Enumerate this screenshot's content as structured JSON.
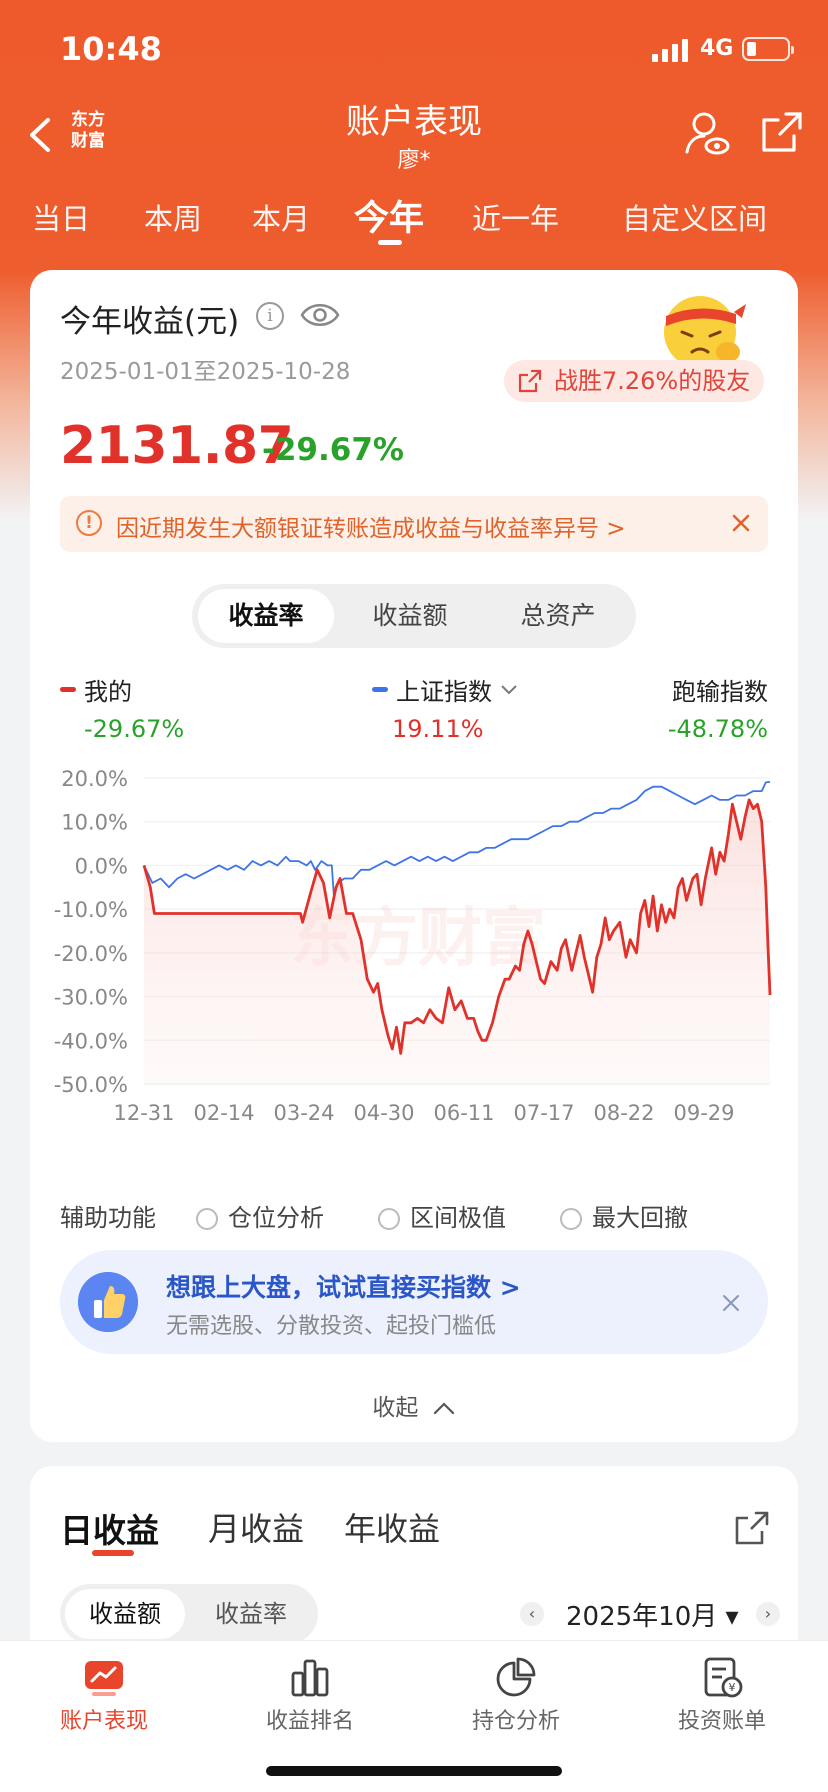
{
  "status": {
    "time": "10:48",
    "network": "4G"
  },
  "header": {
    "logo": "东方财富",
    "title": "账户表现",
    "subtitle": "廖*"
  },
  "periods": [
    "当日",
    "本周",
    "本月",
    "今年",
    "近一年",
    "自定义区间"
  ],
  "active_period": "今年",
  "summary": {
    "title": "今年收益(元)",
    "date_range": "2025-01-01至2025-10-28",
    "beat": "战胜7.26%的股友",
    "amount": "2131.87",
    "rate": "-29.67%",
    "notice": "因近期发生大额银证转账造成收益与收益率异号 >"
  },
  "segments": [
    "收益率",
    "收益额",
    "总资产"
  ],
  "legend": {
    "mine_label": "我的",
    "mine_value": "-29.67%",
    "index_label": "上证指数",
    "index_value": "19.11%",
    "diff_label": "跑输指数",
    "diff_value": "-48.78%"
  },
  "colors": {
    "brand": "#ee5a2b",
    "mine": "#e0322b",
    "index": "#3f74e6",
    "gain": "#2aa22a",
    "loss": "#e0322b"
  },
  "chart_data": {
    "type": "line",
    "x_tick_labels": [
      "12-31",
      "02-14",
      "03-24",
      "04-30",
      "06-11",
      "07-17",
      "08-22",
      "09-29"
    ],
    "y_tick_labels": [
      "20.0%",
      "10.0%",
      "0.0%",
      "-10.0%",
      "-20.0%",
      "-30.0%",
      "-40.0%",
      "-50.0%"
    ],
    "ylim": [
      -50,
      20
    ],
    "grid": true,
    "x_extent": [
      0,
      300
    ],
    "x_note": "days since 2024-12-31",
    "series": [
      {
        "name": "我的",
        "points": [
          [
            0,
            0
          ],
          [
            3,
            -5
          ],
          [
            5,
            -11
          ],
          [
            20,
            -11
          ],
          [
            40,
            -11
          ],
          [
            60,
            -11
          ],
          [
            75,
            -11
          ],
          [
            76,
            -13
          ],
          [
            80,
            -6
          ],
          [
            83,
            -1
          ],
          [
            86,
            -4
          ],
          [
            89,
            -12
          ],
          [
            92,
            -5
          ],
          [
            94,
            -3
          ],
          [
            97,
            -11
          ],
          [
            100,
            -11
          ],
          [
            104,
            -17
          ],
          [
            107,
            -26
          ],
          [
            110,
            -29
          ],
          [
            112,
            -27
          ],
          [
            114,
            -33
          ],
          [
            117,
            -39
          ],
          [
            119,
            -42
          ],
          [
            121,
            -37
          ],
          [
            123,
            -43
          ],
          [
            125,
            -36
          ],
          [
            128,
            -36
          ],
          [
            131,
            -35
          ],
          [
            134,
            -36
          ],
          [
            137,
            -33
          ],
          [
            140,
            -35
          ],
          [
            143,
            -36
          ],
          [
            146,
            -28
          ],
          [
            149,
            -33
          ],
          [
            152,
            -31
          ],
          [
            155,
            -35
          ],
          [
            158,
            -35
          ],
          [
            160,
            -38
          ],
          [
            162,
            -40
          ],
          [
            164,
            -40
          ],
          [
            167,
            -36
          ],
          [
            170,
            -30
          ],
          [
            173,
            -26
          ],
          [
            175,
            -26
          ],
          [
            178,
            -23
          ],
          [
            180,
            -24
          ],
          [
            182,
            -18
          ],
          [
            184,
            -15
          ],
          [
            186,
            -18
          ],
          [
            188,
            -22
          ],
          [
            190,
            -26
          ],
          [
            192,
            -27
          ],
          [
            195,
            -22
          ],
          [
            198,
            -24
          ],
          [
            200,
            -19
          ],
          [
            202,
            -17
          ],
          [
            205,
            -24
          ],
          [
            207,
            -20
          ],
          [
            209,
            -16
          ],
          [
            211,
            -21
          ],
          [
            213,
            -25
          ],
          [
            215,
            -29
          ],
          [
            217,
            -21
          ],
          [
            219,
            -18
          ],
          [
            221,
            -12
          ],
          [
            223,
            -17
          ],
          [
            225,
            -15
          ],
          [
            228,
            -13
          ],
          [
            231,
            -21
          ],
          [
            233,
            -17
          ],
          [
            236,
            -20
          ],
          [
            238,
            -11
          ],
          [
            240,
            -8
          ],
          [
            242,
            -14
          ],
          [
            244,
            -7
          ],
          [
            246,
            -15
          ],
          [
            248,
            -9
          ],
          [
            250,
            -13
          ],
          [
            252,
            -10
          ],
          [
            254,
            -12
          ],
          [
            256,
            -5
          ],
          [
            258,
            -3
          ],
          [
            260,
            -8
          ],
          [
            263,
            -3
          ],
          [
            265,
            -2
          ],
          [
            267,
            -9
          ],
          [
            269,
            -3
          ],
          [
            272,
            4
          ],
          [
            274,
            -2
          ],
          [
            276,
            3
          ],
          [
            278,
            1
          ],
          [
            280,
            7
          ],
          [
            282,
            14
          ],
          [
            284,
            10
          ],
          [
            286,
            6
          ],
          [
            288,
            11
          ],
          [
            290,
            15
          ],
          [
            292,
            13
          ],
          [
            294,
            14
          ],
          [
            296,
            10
          ],
          [
            298,
            -5
          ],
          [
            299,
            -18
          ],
          [
            300,
            -29.67
          ]
        ]
      },
      {
        "name": "上证指数",
        "points": [
          [
            0,
            0
          ],
          [
            4,
            -4
          ],
          [
            8,
            -3
          ],
          [
            12,
            -5
          ],
          [
            16,
            -3
          ],
          [
            20,
            -2
          ],
          [
            24,
            -3
          ],
          [
            28,
            -2
          ],
          [
            32,
            -1
          ],
          [
            36,
            0
          ],
          [
            40,
            -1
          ],
          [
            44,
            0
          ],
          [
            48,
            -1
          ],
          [
            52,
            1
          ],
          [
            56,
            0
          ],
          [
            60,
            1
          ],
          [
            64,
            0
          ],
          [
            68,
            2
          ],
          [
            70,
            1
          ],
          [
            74,
            1
          ],
          [
            78,
            0
          ],
          [
            80,
            1
          ],
          [
            82,
            -1
          ],
          [
            85,
            1
          ],
          [
            88,
            0
          ],
          [
            90,
            0
          ],
          [
            91,
            -7
          ],
          [
            93,
            -4
          ],
          [
            96,
            -3
          ],
          [
            100,
            -3
          ],
          [
            104,
            -1
          ],
          [
            108,
            -1
          ],
          [
            112,
            0
          ],
          [
            116,
            1
          ],
          [
            120,
            0
          ],
          [
            124,
            1
          ],
          [
            128,
            2
          ],
          [
            132,
            1
          ],
          [
            136,
            2
          ],
          [
            140,
            1
          ],
          [
            144,
            2
          ],
          [
            148,
            1
          ],
          [
            152,
            2
          ],
          [
            156,
            3
          ],
          [
            160,
            3
          ],
          [
            164,
            4
          ],
          [
            168,
            4
          ],
          [
            172,
            5
          ],
          [
            176,
            6
          ],
          [
            180,
            6
          ],
          [
            184,
            6
          ],
          [
            188,
            7
          ],
          [
            192,
            8
          ],
          [
            196,
            9
          ],
          [
            200,
            9
          ],
          [
            204,
            10
          ],
          [
            208,
            10
          ],
          [
            212,
            11
          ],
          [
            216,
            12
          ],
          [
            220,
            12
          ],
          [
            224,
            13
          ],
          [
            228,
            13
          ],
          [
            232,
            14
          ],
          [
            236,
            15
          ],
          [
            240,
            17
          ],
          [
            244,
            18
          ],
          [
            248,
            18
          ],
          [
            252,
            17
          ],
          [
            256,
            16
          ],
          [
            260,
            15
          ],
          [
            264,
            14
          ],
          [
            268,
            15
          ],
          [
            272,
            16
          ],
          [
            276,
            15
          ],
          [
            280,
            15
          ],
          [
            284,
            16
          ],
          [
            288,
            16
          ],
          [
            292,
            17
          ],
          [
            296,
            17
          ],
          [
            298,
            19
          ],
          [
            300,
            19.11
          ]
        ]
      }
    ]
  },
  "aux": {
    "title": "辅助功能",
    "options": [
      "仓位分析",
      "区间极值",
      "最大回撤"
    ]
  },
  "promo": {
    "title": "想跟上大盘，试试直接买指数 >",
    "subtitle": "无需选股、分散投资、起投门槛低"
  },
  "collapse_label": "收起",
  "earnings": {
    "tabs": [
      "日收益",
      "月收益",
      "年收益"
    ],
    "segments": [
      "收益额",
      "收益率"
    ],
    "month": "2025年10月"
  },
  "tabbar": [
    "账户表现",
    "收益排名",
    "持仓分析",
    "投资账单"
  ]
}
